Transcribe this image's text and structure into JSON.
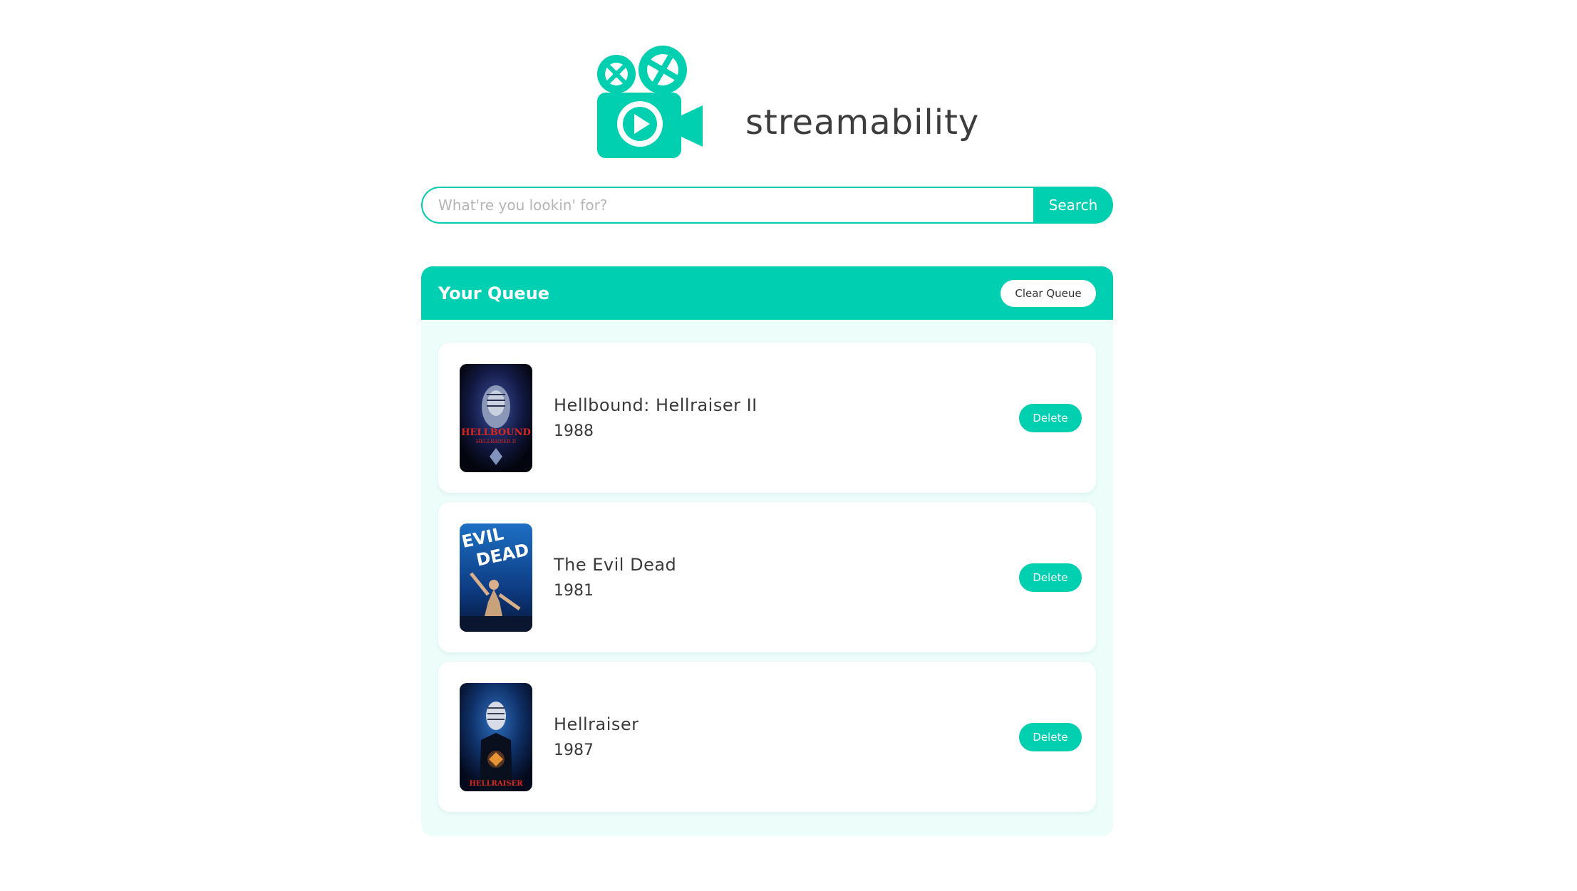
{
  "brand": {
    "name": "streamability",
    "logo_icon": "film-camera-play-icon",
    "accent_color": "#00cfb0"
  },
  "search": {
    "placeholder": "What're you lookin' for?",
    "value": "",
    "button_label": "Search"
  },
  "queue": {
    "title": "Your Queue",
    "clear_label": "Clear Queue",
    "items": [
      {
        "title": "Hellbound: Hellraiser II",
        "year": "1988",
        "delete_label": "Delete",
        "poster_text": "HELLBOUND HELLRAISER II"
      },
      {
        "title": "The Evil Dead",
        "year": "1981",
        "delete_label": "Delete",
        "poster_text": "THE EVIL DEAD"
      },
      {
        "title": "Hellraiser",
        "year": "1987",
        "delete_label": "Delete",
        "poster_text": "HELLRAISER"
      }
    ]
  }
}
